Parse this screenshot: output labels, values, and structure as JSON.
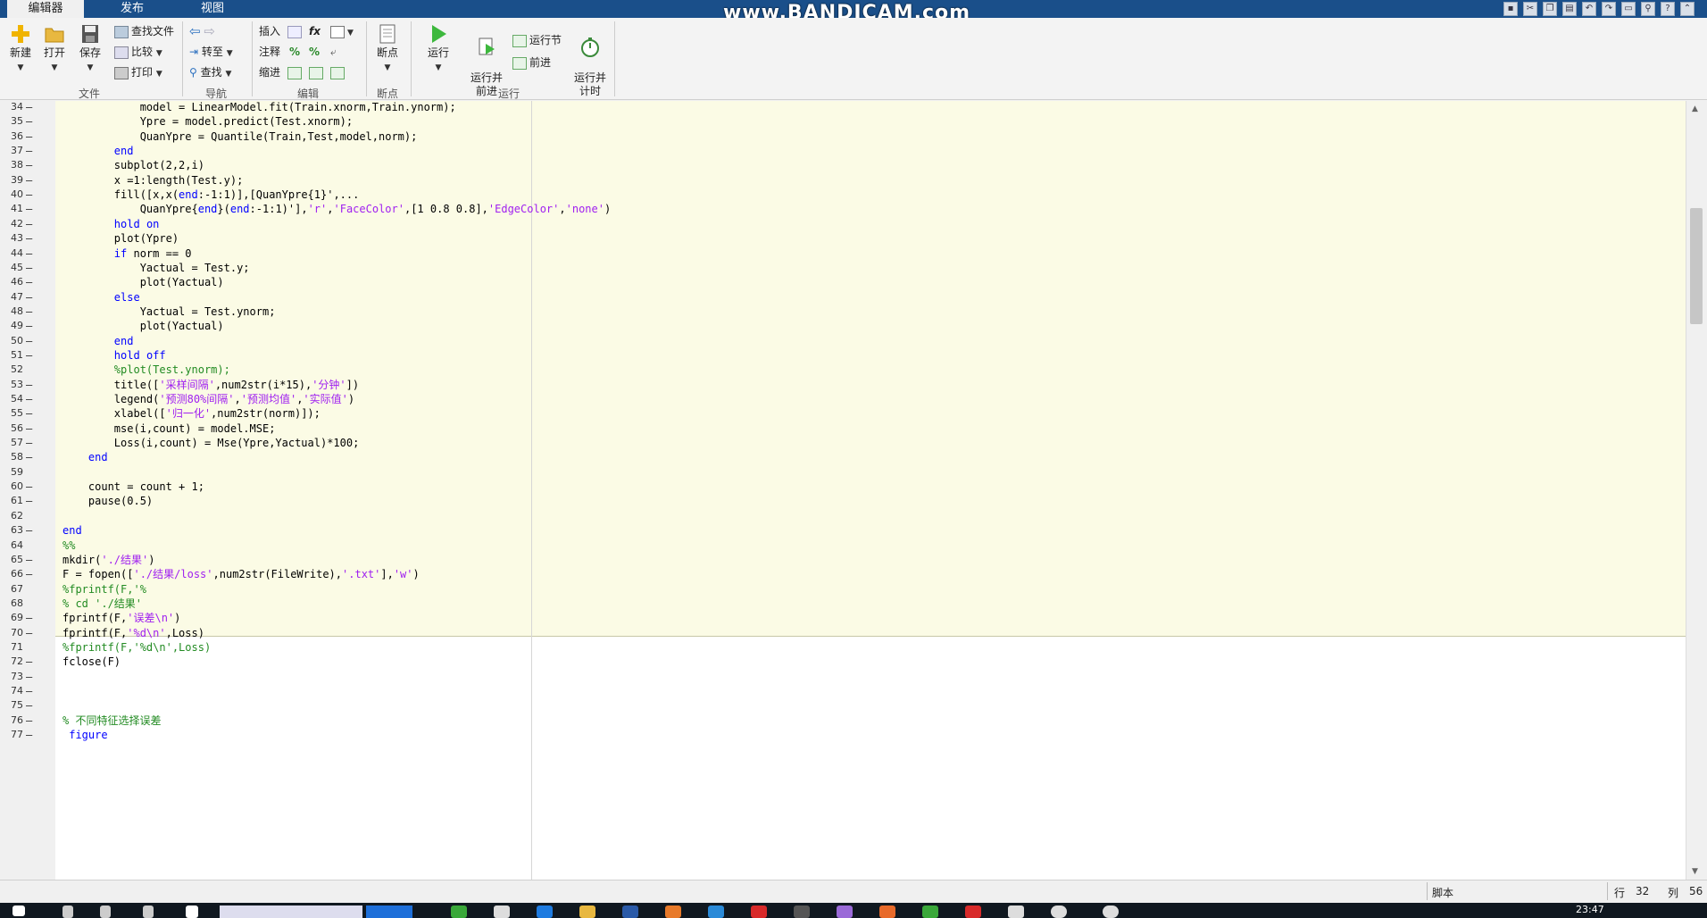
{
  "tabs": [
    {
      "label": "编辑器",
      "active": true
    },
    {
      "label": "发布",
      "active": false
    },
    {
      "label": "视图",
      "active": false
    }
  ],
  "watermark": "www.BANDICAM.com",
  "ribbon": {
    "file": {
      "label": "文件",
      "new": "新建",
      "open": "打开",
      "save": "保存",
      "find_files": "查找文件",
      "compare": "比较",
      "print": "打印"
    },
    "navigate": {
      "label": "导航",
      "goto": "转至",
      "find": "查找"
    },
    "edit": {
      "label": "编辑",
      "insert": "插入",
      "comment": "注释",
      "indent": "缩进",
      "fx": "fx"
    },
    "breakpoints": {
      "label": "断点",
      "breakpoints": "断点"
    },
    "run": {
      "label": "运行",
      "run": "运行",
      "run_advance": "运行并\n前进",
      "run_section": "运行节",
      "advance": "前进",
      "run_time": "运行并\n计时"
    }
  },
  "code_lines": [
    {
      "n": "34",
      "t": "            model = LinearModel.fit(Train.xnorm,Train.ynorm);"
    },
    {
      "n": "35",
      "t": "            Ypre = model.predict(Test.xnorm);"
    },
    {
      "n": "36",
      "t": "            QuanYpre = Quantile(Train,Test,model,norm);"
    },
    {
      "n": "37",
      "t": "        end"
    },
    {
      "n": "38",
      "t": "        subplot(2,2,i)"
    },
    {
      "n": "39",
      "t": "        x =1:length(Test.y);"
    },
    {
      "n": "40",
      "t": "        fill([x,x(end:-1:1)],[QuanYpre{1}',..."
    },
    {
      "n": "41",
      "t": "            QuanYpre{end}(end:-1:1)'],'r','FaceColor',[1 0.8 0.8],'EdgeColor','none')"
    },
    {
      "n": "42",
      "t": "        hold on"
    },
    {
      "n": "43",
      "t": "        plot(Ypre)"
    },
    {
      "n": "44",
      "t": "        if norm == 0"
    },
    {
      "n": "45",
      "t": "            Yactual = Test.y;"
    },
    {
      "n": "46",
      "t": "            plot(Yactual)"
    },
    {
      "n": "47",
      "t": "        else"
    },
    {
      "n": "48",
      "t": "            Yactual = Test.ynorm;"
    },
    {
      "n": "49",
      "t": "            plot(Yactual)"
    },
    {
      "n": "50",
      "t": "        end"
    },
    {
      "n": "51",
      "t": "        hold off"
    },
    {
      "n": "52",
      "t": "        %plot(Test.ynorm);"
    },
    {
      "n": "53",
      "t": "        title(['采样间隔',num2str(i*15),'分钟'])"
    },
    {
      "n": "54",
      "t": "        legend('预测80%间隔','预测均值','实际值')"
    },
    {
      "n": "55",
      "t": "        xlabel(['归一化',num2str(norm)]);"
    },
    {
      "n": "56",
      "t": "        mse(i,count) = model.MSE;"
    },
    {
      "n": "57",
      "t": "        Loss(i,count) = Mse(Ypre,Yactual)*100;"
    },
    {
      "n": "58",
      "t": "    end"
    },
    {
      "n": "59",
      "t": ""
    },
    {
      "n": "60",
      "t": "    count = count + 1;"
    },
    {
      "n": "61",
      "t": "    pause(0.5)"
    },
    {
      "n": "62",
      "t": ""
    },
    {
      "n": "63",
      "t": "end"
    },
    {
      "n": "64",
      "t": "%%"
    },
    {
      "n": "65",
      "t": "mkdir('./结果')"
    },
    {
      "n": "66",
      "t": "F = fopen(['./结果/loss',num2str(FileWrite),'.txt'],'w')"
    },
    {
      "n": "67",
      "t": "%fprintf(F,'%"
    },
    {
      "n": "68",
      "t": "% cd './结果'"
    },
    {
      "n": "69",
      "t": "fprintf(F,'误差\\n')"
    },
    {
      "n": "70",
      "t": "fprintf(F,'%d\\n',Loss)"
    },
    {
      "n": "71",
      "t": "%fprintf(F,'%d\\n',Loss)"
    },
    {
      "n": "72",
      "t": "fclose(F)"
    },
    {
      "n": "73",
      "t": ""
    },
    {
      "n": "74",
      "t": ""
    },
    {
      "n": "75",
      "t": ""
    },
    {
      "n": "76",
      "t": "% 不同特征选择误差"
    },
    {
      "n": "77",
      "t": " figure"
    }
  ],
  "status": {
    "mode": "脚本",
    "row_label": "行",
    "row": "32",
    "col_label": "列",
    "col": "56"
  },
  "clock": "23:47",
  "colors": {
    "tab_bar": "#1a4f8a",
    "cell_bg": "#fbfbe5",
    "keyword": "#0000ff",
    "string": "#a020f0",
    "comment": "#228b22"
  }
}
